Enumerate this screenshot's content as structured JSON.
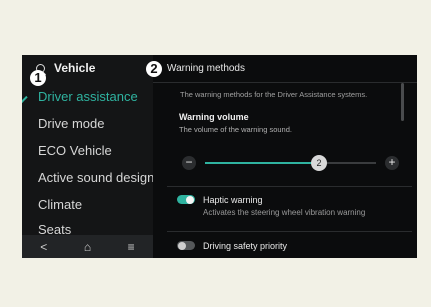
{
  "sidebar": {
    "title": "Vehicle",
    "items": [
      {
        "label": "Driver assistance",
        "active": true
      },
      {
        "label": "Drive mode"
      },
      {
        "label": "ECO Vehicle"
      },
      {
        "label": "Active sound design"
      },
      {
        "label": "Climate"
      },
      {
        "label": "Seats"
      }
    ],
    "nav": {
      "back": "<",
      "home": "⌂",
      "menu": "≡"
    }
  },
  "badges": [
    "1",
    "2"
  ],
  "panel": {
    "title": "Warning methods",
    "description": "The warning methods for the Driver Assistance systems.",
    "volume": {
      "title": "Warning volume",
      "description": "The volume of the warning sound.",
      "value": "2",
      "max": 3,
      "minus": "−",
      "plus": "+"
    },
    "haptic": {
      "title": "Haptic warning",
      "description": "Activates the steering wheel vibration warning",
      "enabled": true
    },
    "safety": {
      "title": "Driving safety priority",
      "enabled": false
    }
  },
  "colors": {
    "accent": "#2fb3a0",
    "background": "#0b0c0d"
  }
}
